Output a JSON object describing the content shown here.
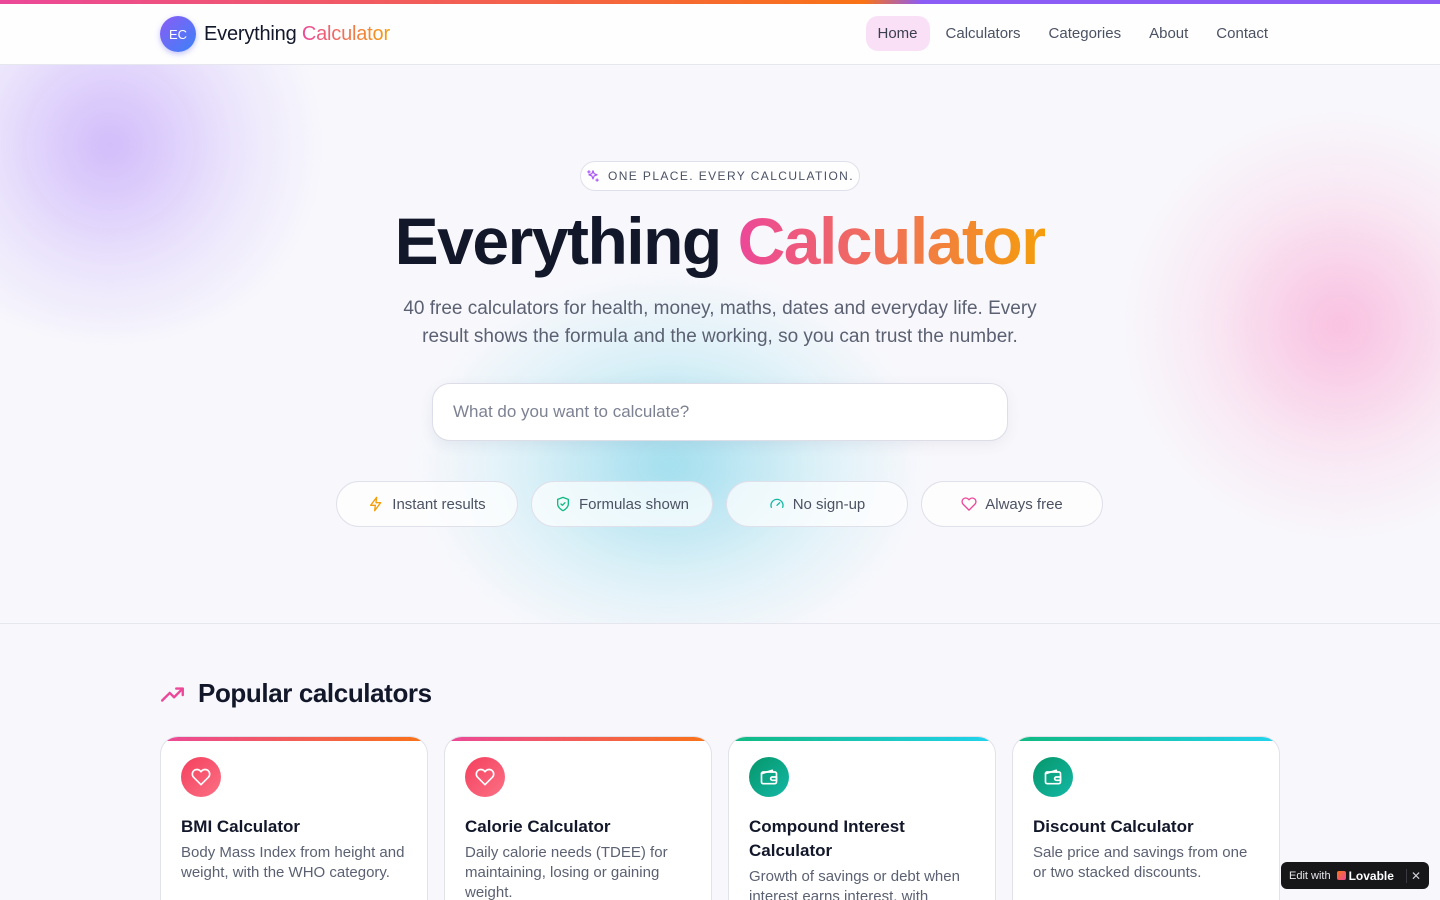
{
  "brand": {
    "badge": "EC",
    "name_plain": "Everything",
    "name_accent": "Calculator"
  },
  "nav": {
    "items": [
      {
        "label": "Home",
        "active": true
      },
      {
        "label": "Calculators",
        "active": false
      },
      {
        "label": "Categories",
        "active": false
      },
      {
        "label": "About",
        "active": false
      },
      {
        "label": "Contact",
        "active": false
      }
    ]
  },
  "hero": {
    "eyebrow": "ONE PLACE. EVERY CALCULATION.",
    "eyebrow_icon": "sparkles-icon",
    "title_plain": "Everything",
    "title_accent": "Calculator",
    "subtitle": "40 free calculators for health, money, maths, dates and everyday life. Every result shows the formula and the working, so you can trust the number.",
    "search_placeholder": "What do you want to calculate?",
    "search_value": "",
    "features": [
      {
        "label": "Instant results",
        "icon": "zap-icon",
        "color": "#f59e0b"
      },
      {
        "label": "Formulas shown",
        "icon": "shield-check-icon",
        "color": "#10b981"
      },
      {
        "label": "No sign-up",
        "icon": "gauge-icon",
        "color": "#14b8a6"
      },
      {
        "label": "Always free",
        "icon": "heart-icon",
        "color": "#ec4899"
      }
    ]
  },
  "popular": {
    "title": "Popular calculators",
    "icon": "trending-up-icon",
    "cards": [
      {
        "title": "BMI Calculator",
        "description": "Body Mass Index from height and weight, with the WHO category.",
        "icon": "heart-icon",
        "category": "health"
      },
      {
        "title": "Calorie Calculator",
        "description": "Daily calorie needs (TDEE) for maintaining, losing or gaining weight.",
        "icon": "heart-icon",
        "category": "health"
      },
      {
        "title": "Compound Interest Calculator",
        "description": "Growth of savings or debt when interest earns interest, with",
        "icon": "wallet-icon",
        "category": "money"
      },
      {
        "title": "Discount Calculator",
        "description": "Sale price and savings from one or two stacked discounts.",
        "icon": "wallet-icon",
        "category": "money"
      }
    ]
  },
  "lovable_badge": {
    "prefix": "Edit with",
    "brand": "Lovable",
    "close": "✕"
  },
  "colors": {
    "accent_gradient_start": "#ec4899",
    "accent_gradient_end": "#f59e0b",
    "nav_active_bg": "#fae0f7",
    "text_primary": "#12172a"
  }
}
